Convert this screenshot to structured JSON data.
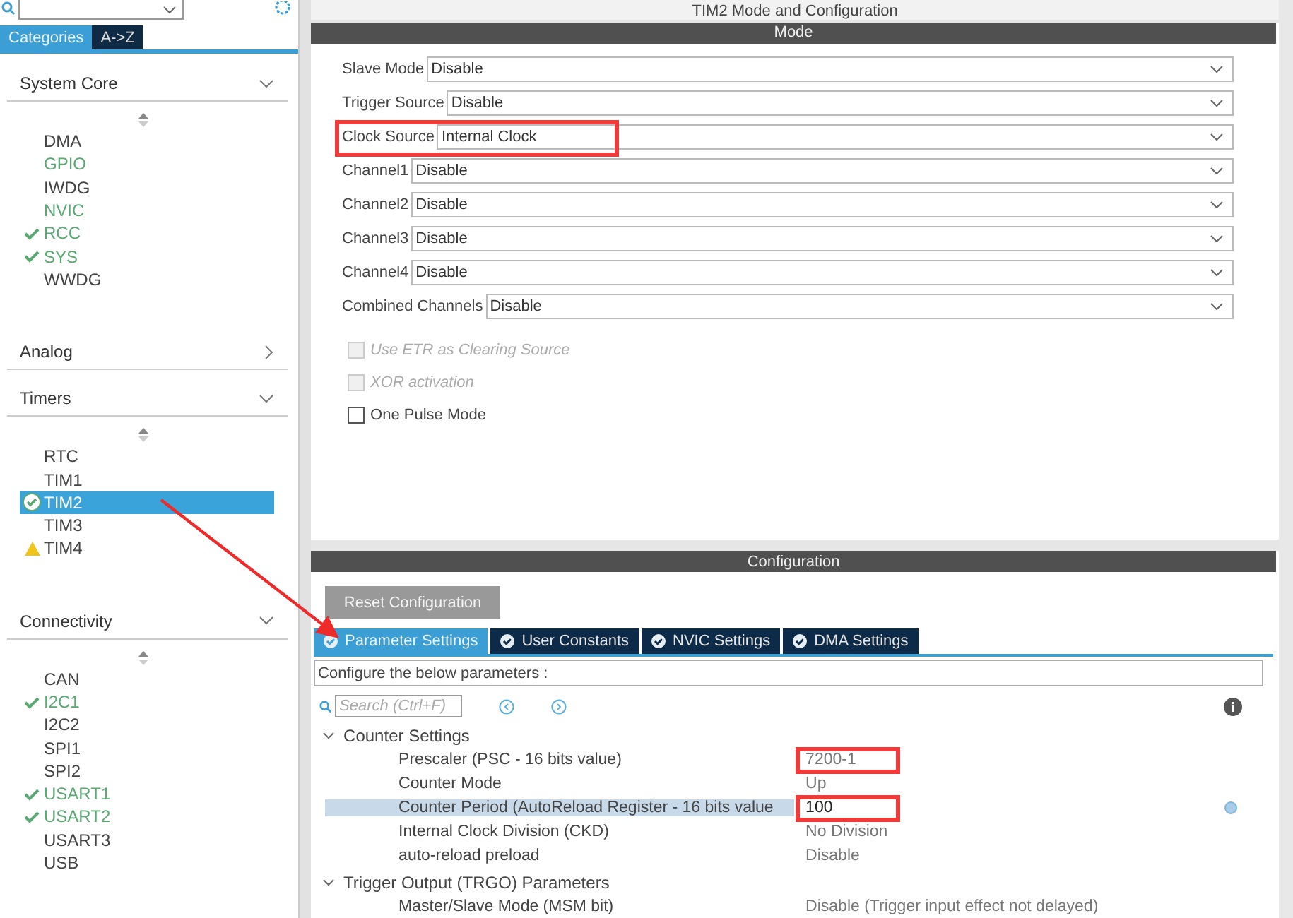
{
  "sidebar": {
    "tabs": [
      {
        "label": "Categories",
        "selected": true
      },
      {
        "label": "A->Z",
        "selected": false
      }
    ],
    "sections": [
      {
        "title": "System Core",
        "expanded": true,
        "items": [
          {
            "label": "DMA",
            "kind": "none",
            "selected": false
          },
          {
            "label": "GPIO",
            "kind": "enabled",
            "selected": false
          },
          {
            "label": "IWDG",
            "kind": "none",
            "selected": false
          },
          {
            "label": "NVIC",
            "kind": "enabled",
            "selected": false
          },
          {
            "label": "RCC",
            "kind": "ok",
            "selected": false
          },
          {
            "label": "SYS",
            "kind": "ok",
            "selected": false
          },
          {
            "label": "WWDG",
            "kind": "none",
            "selected": false
          }
        ]
      },
      {
        "title": "Analog",
        "expanded": false
      },
      {
        "title": "Timers",
        "expanded": true,
        "items": [
          {
            "label": "RTC",
            "kind": "none",
            "selected": false
          },
          {
            "label": "TIM1",
            "kind": "none",
            "selected": false
          },
          {
            "label": "TIM2",
            "kind": "ok",
            "selected": true
          },
          {
            "label": "TIM3",
            "kind": "none",
            "selected": false
          },
          {
            "label": "TIM4",
            "kind": "warning",
            "selected": false
          }
        ]
      },
      {
        "title": "Connectivity",
        "expanded": true,
        "items": [
          {
            "label": "CAN",
            "kind": "none",
            "selected": false
          },
          {
            "label": "I2C1",
            "kind": "ok",
            "selected": false
          },
          {
            "label": "I2C2",
            "kind": "none",
            "selected": false
          },
          {
            "label": "SPI1",
            "kind": "none",
            "selected": false
          },
          {
            "label": "SPI2",
            "kind": "none",
            "selected": false
          },
          {
            "label": "USART1",
            "kind": "ok",
            "selected": false
          },
          {
            "label": "USART2",
            "kind": "ok",
            "selected": false
          },
          {
            "label": "USART3",
            "kind": "none",
            "selected": false
          },
          {
            "label": "USB",
            "kind": "none",
            "selected": false
          }
        ]
      }
    ]
  },
  "mode": {
    "title": "TIM2 Mode and Configuration",
    "header": "Mode",
    "rows": [
      {
        "label": "Slave Mode",
        "value": "Disable",
        "highlighted": false
      },
      {
        "label": "Trigger Source",
        "value": "Disable",
        "highlighted": false
      },
      {
        "label": "Clock Source",
        "value": "Internal Clock",
        "highlighted": true
      },
      {
        "label": "Channel1",
        "value": "Disable",
        "highlighted": false
      },
      {
        "label": "Channel2",
        "value": "Disable",
        "highlighted": false
      },
      {
        "label": "Channel3",
        "value": "Disable",
        "highlighted": false
      },
      {
        "label": "Channel4",
        "value": "Disable",
        "highlighted": false
      },
      {
        "label": "Combined Channels",
        "value": "Disable",
        "highlighted": false
      }
    ],
    "checkboxes": [
      {
        "label": "Use ETR as Clearing Source",
        "checked": false,
        "disabled": true
      },
      {
        "label": "XOR activation",
        "checked": false,
        "disabled": true
      },
      {
        "label": "One Pulse Mode",
        "checked": false,
        "disabled": false
      }
    ]
  },
  "configuration": {
    "header": "Configuration",
    "reset_button": "Reset Configuration",
    "tabs": [
      {
        "label": "Parameter Settings",
        "selected": true
      },
      {
        "label": "User Constants",
        "selected": false
      },
      {
        "label": "NVIC Settings",
        "selected": false
      },
      {
        "label": "DMA Settings",
        "selected": false
      }
    ],
    "description": "Configure the below parameters :",
    "search": {
      "placeholder": "Search (Ctrl+F)"
    },
    "groups": [
      {
        "title": "Counter Settings",
        "expanded": true,
        "children": [
          {
            "name": "Prescaler (PSC - 16 bits value)",
            "value": "7200-1",
            "selected": false,
            "highlighted": true
          },
          {
            "name": "Counter Mode",
            "value": "Up",
            "selected": false,
            "highlighted": false
          },
          {
            "name": "Counter Period (AutoReload Register - 16 bits value",
            "value": "100",
            "selected": true,
            "highlighted": true
          },
          {
            "name": "Internal Clock Division (CKD)",
            "value": "No Division",
            "selected": false,
            "highlighted": false
          },
          {
            "name": "auto-reload preload",
            "value": "Disable",
            "selected": false,
            "highlighted": false
          }
        ]
      },
      {
        "title": "Trigger Output (TRGO) Parameters",
        "expanded": true,
        "children": [
          {
            "name": "Master/Slave Mode (MSM bit)",
            "value": "Disable (Trigger input effect not delayed)",
            "selected": false,
            "highlighted": false
          }
        ]
      }
    ]
  }
}
